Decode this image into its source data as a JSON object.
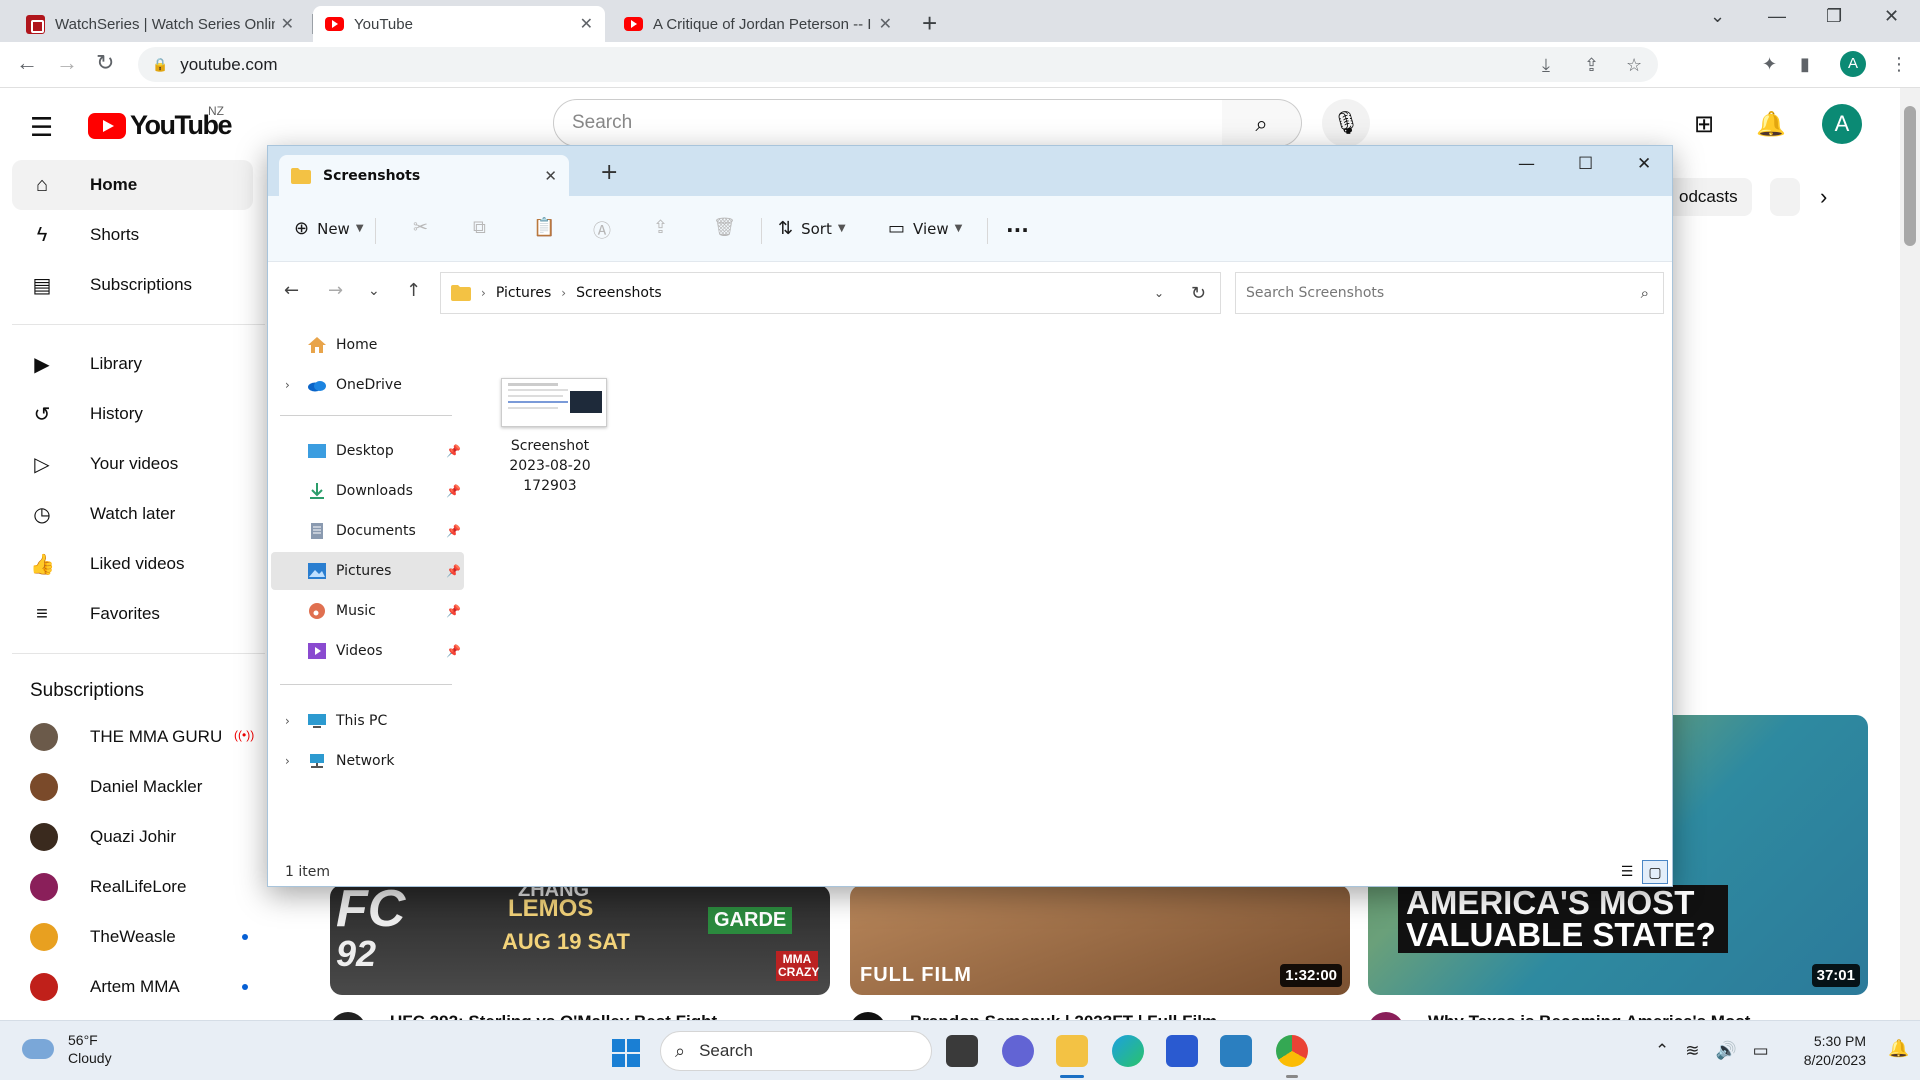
{
  "browser": {
    "tabs": [
      {
        "title": "WatchSeries | Watch Series Online",
        "favicon": "watchseries-icon"
      },
      {
        "title": "YouTube",
        "favicon": "youtube-icon",
        "active": true
      },
      {
        "title": "A Critique of Jordan Peterson -- I",
        "favicon": "youtube-icon"
      }
    ],
    "url": "youtube.com",
    "profile_initial": "A"
  },
  "youtube": {
    "region": "NZ",
    "logo_text": "YouTube",
    "search_placeholder": "Search",
    "avatar_initial": "A",
    "sidebar": {
      "main": [
        {
          "label": "Home",
          "icon": "home-icon",
          "active": true
        },
        {
          "label": "Shorts",
          "icon": "shorts-icon"
        },
        {
          "label": "Subscriptions",
          "icon": "subscriptions-icon"
        }
      ],
      "library": [
        {
          "label": "Library",
          "icon": "library-icon"
        },
        {
          "label": "History",
          "icon": "history-icon"
        },
        {
          "label": "Your videos",
          "icon": "your-videos-icon"
        },
        {
          "label": "Watch later",
          "icon": "watch-later-icon"
        },
        {
          "label": "Liked videos",
          "icon": "liked-videos-icon"
        },
        {
          "label": "Favorites",
          "icon": "playlist-icon"
        }
      ],
      "subscriptions_heading": "Subscriptions",
      "subscriptions": [
        {
          "name": "THE MMA GURU",
          "live": true,
          "color": "#6b5a4a"
        },
        {
          "name": "Daniel Mackler",
          "color": "#7a4a2a"
        },
        {
          "name": "Quazi Johir",
          "color": "#3a2a1e"
        },
        {
          "name": "RealLifeLore",
          "color": "#8a1f5a"
        },
        {
          "name": "TheWeasle",
          "new": true,
          "color": "#e8a020"
        },
        {
          "name": "Artem MMA",
          "new": true,
          "color": "#c0201a"
        }
      ]
    },
    "chips_right": [
      "odcasts"
    ],
    "videos": [
      {
        "duration": "",
        "overlay_top": "ZHANG",
        "overlay_vs": "LEMOS",
        "overlay_date": "AUG 19 SAT",
        "overlay_left": "FC",
        "overlay_num": "92",
        "sponsor": "GARDE",
        "badge": "MMA CRAZY",
        "title": "UFC 292: Sterling vs O'Malley Best Fight"
      },
      {
        "duration": "1:32:00",
        "label": "FULL FILM",
        "title": "Brandon Semenuk | 2023FT | Full Film"
      },
      {
        "duration": "37:01",
        "headline": "AMERICA'S MOST VALUABLE STATE?",
        "title": "Why Texas is Becoming America's Most"
      }
    ]
  },
  "explorer": {
    "tab_title": "Screenshots",
    "toolbar": {
      "new_label": "New",
      "sort_label": "Sort",
      "view_label": "View"
    },
    "breadcrumb": [
      "Pictures",
      "Screenshots"
    ],
    "search_placeholder": "Search Screenshots",
    "nav": {
      "top": [
        {
          "label": "Home",
          "icon": "home-icon"
        },
        {
          "label": "OneDrive",
          "icon": "onedrive-icon",
          "expandable": true
        }
      ],
      "quick": [
        {
          "label": "Desktop",
          "icon": "desktop-icon"
        },
        {
          "label": "Downloads",
          "icon": "downloads-icon"
        },
        {
          "label": "Documents",
          "icon": "documents-icon"
        },
        {
          "label": "Pictures",
          "icon": "pictures-icon",
          "selected": true
        },
        {
          "label": "Music",
          "icon": "music-icon"
        },
        {
          "label": "Videos",
          "icon": "videos-icon"
        }
      ],
      "devices": [
        {
          "label": "This PC",
          "icon": "this-pc-icon",
          "expandable": true
        },
        {
          "label": "Network",
          "icon": "network-icon",
          "expandable": true
        }
      ]
    },
    "files": [
      {
        "name_lines": [
          "Screenshot",
          "2023-08-20",
          "172903"
        ]
      }
    ],
    "status": "1 item"
  },
  "taskbar": {
    "weather_temp": "56°F",
    "weather_desc": "Cloudy",
    "search_label": "Search",
    "time": "5:30 PM",
    "date": "8/20/2023"
  },
  "colors": {
    "youtube_red": "#ff0000",
    "explorer_titlebar": "#cfe2f1",
    "explorer_toolbar": "#f3f9fd",
    "taskbar_bg": "#e8eef5",
    "avatar_green": "#0b8a74"
  }
}
